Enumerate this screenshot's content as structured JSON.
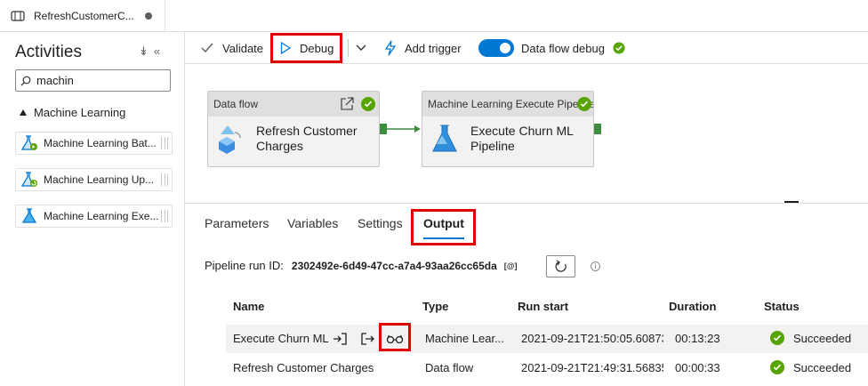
{
  "tab": {
    "title": "RefreshCustomerC..."
  },
  "activities": {
    "title": "Activities",
    "search_value": "machin",
    "group_label": "Machine Learning",
    "items": [
      {
        "label": "Machine Learning Bat...",
        "icon": "ml-batch-icon"
      },
      {
        "label": "Machine Learning Up...",
        "icon": "ml-update-icon"
      },
      {
        "label": "Machine Learning Exe...",
        "icon": "ml-execute-icon"
      }
    ]
  },
  "toolbar": {
    "validate": "Validate",
    "debug": "Debug",
    "add_trigger": "Add trigger",
    "dataflow_debug": "Data flow debug"
  },
  "canvas": {
    "node1": {
      "header": "Data flow",
      "title_line1": "Refresh Customer",
      "title_line2": "Charges"
    },
    "node2": {
      "header": "Machine Learning Execute Pipeline",
      "title_line1": "Execute Churn ML",
      "title_line2": "Pipeline"
    }
  },
  "bottom": {
    "tabs": [
      "Parameters",
      "Variables",
      "Settings",
      "Output"
    ],
    "active_tab": "Output",
    "run_id_label": "Pipeline run ID:",
    "run_id_value": "2302492e-6d49-47cc-a7a4-93aa26cc65da",
    "copy_label": "[@]",
    "columns": [
      "Name",
      "Type",
      "Run start",
      "Duration",
      "Status"
    ],
    "rows": [
      {
        "name": "Execute Churn ML",
        "type": "Machine Lear...",
        "run_start": "2021-09-21T21:50:05.60873",
        "duration": "00:13:23",
        "status": "Succeeded"
      },
      {
        "name": "Refresh Customer Charges",
        "type": "Data flow",
        "run_start": "2021-09-21T21:49:31.56835",
        "duration": "00:00:33",
        "status": "Succeeded"
      }
    ]
  },
  "colors": {
    "accent": "#0078d4",
    "success": "#57a300",
    "highlight": "#e00000"
  }
}
